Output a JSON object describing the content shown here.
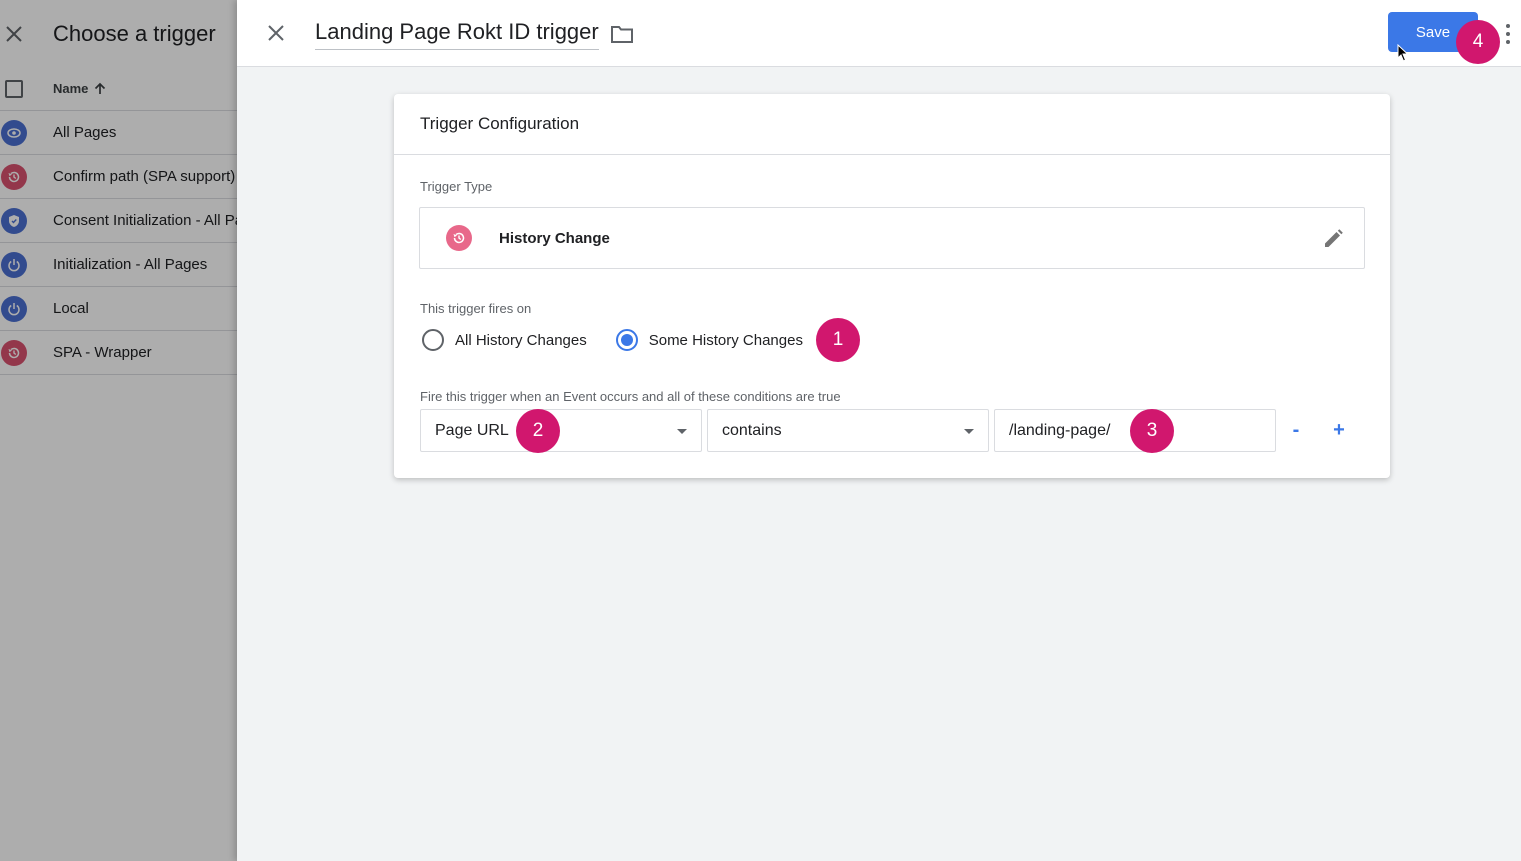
{
  "picker": {
    "title": "Choose a trigger",
    "column_header": "Name",
    "triggers": [
      {
        "label": "All Pages",
        "icon": "eye-icon",
        "color": "#4a6fd1"
      },
      {
        "label": "Confirm path (SPA support)",
        "icon": "history-icon",
        "color": "#d9526f"
      },
      {
        "label": "Consent Initialization - All Pages",
        "icon": "shield-icon",
        "color": "#4a6fd1"
      },
      {
        "label": "Initialization - All Pages",
        "icon": "power-icon",
        "color": "#4a6fd1"
      },
      {
        "label": "Local",
        "icon": "power-icon",
        "color": "#4a6fd1"
      },
      {
        "label": "SPA - Wrapper",
        "icon": "history-icon",
        "color": "#d9526f"
      }
    ]
  },
  "editor": {
    "trigger_name": "Landing Page Rokt ID trigger",
    "save_label": "Save"
  },
  "config": {
    "title": "Trigger Configuration",
    "type_label": "Trigger Type",
    "type_value": "History Change",
    "fires_on_label": "This trigger fires on",
    "option_all": "All History Changes",
    "option_some": "Some History Changes",
    "selected_option": "Some History Changes",
    "conditions_label": "Fire this trigger when an Event occurs and all of these conditions are true",
    "condition": {
      "variable": "Page URL",
      "operator": "contains",
      "value": "/landing-page/"
    },
    "remove_label": "-",
    "add_label": "+"
  },
  "steps": [
    "1",
    "2",
    "3",
    "4"
  ],
  "colors": {
    "accent": "#3b78e7",
    "step_badge": "#d1176e",
    "history_icon": "#e8688a"
  }
}
